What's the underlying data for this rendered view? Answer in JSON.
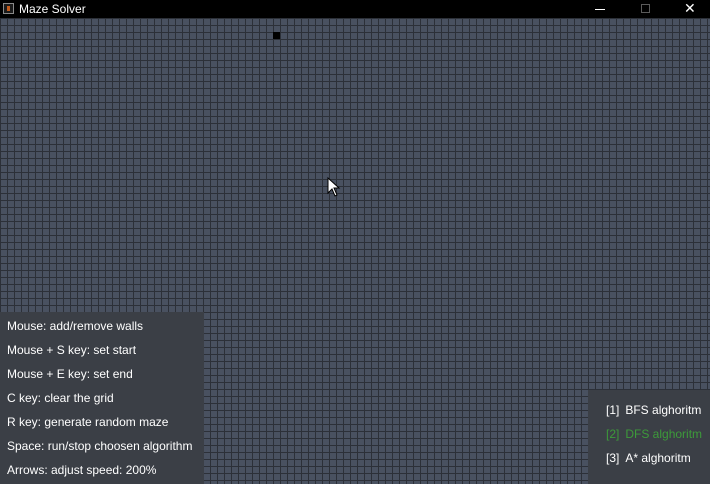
{
  "window": {
    "title": "Maze Solver",
    "minimize_symbol": "—",
    "maximize_symbol": "☐",
    "close_symbol": "✕"
  },
  "grid": {
    "cell_color": "#495160",
    "line_color": "#2c3038",
    "wall_color": "#000000",
    "walls": [
      {
        "col": 39,
        "row": 2
      }
    ]
  },
  "controls": [
    "Mouse: add/remove walls",
    "Mouse + S key: set start",
    "Mouse + E key: set end",
    "C key: clear the grid",
    "R key: generate random maze",
    "Space: run/stop choosen algorithm",
    "Arrows: adjust speed: 200%"
  ],
  "algorithms": [
    {
      "key": "[1]",
      "name": "BFS alghoritm",
      "selected": false
    },
    {
      "key": "[2]",
      "name": "DFS alghoritm",
      "selected": true
    },
    {
      "key": "[3]",
      "name": "A* alghoritm",
      "selected": false
    }
  ],
  "colors": {
    "titlebar": "#000000",
    "panel": "#3b3f46",
    "text": "#ffffff",
    "selected_algorithm": "#3d9b3a"
  },
  "icons": {
    "app": "java-app-icon",
    "cursor": "mouse-pointer-icon"
  }
}
